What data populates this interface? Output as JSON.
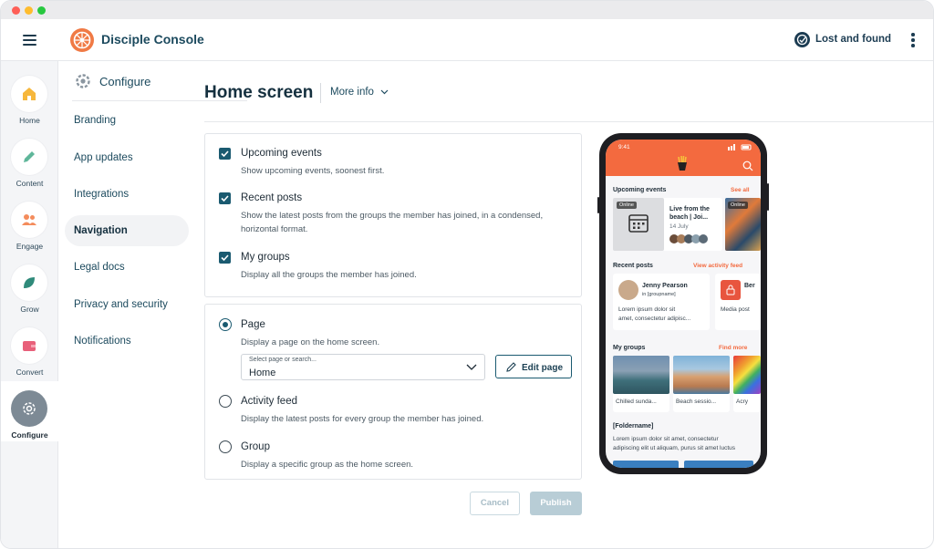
{
  "header": {
    "brand": "Disciple Console",
    "account": "Lost and found"
  },
  "rail": [
    {
      "label": "Home",
      "icon": "home-icon",
      "active": false
    },
    {
      "label": "Content",
      "icon": "pencil-icon",
      "active": false
    },
    {
      "label": "Engage",
      "icon": "people-icon",
      "active": false
    },
    {
      "label": "Grow",
      "icon": "leaf-icon",
      "active": false
    },
    {
      "label": "Convert",
      "icon": "wallet-icon",
      "active": false
    },
    {
      "label": "Configure",
      "icon": "gear-icon",
      "active": true
    }
  ],
  "subnav": {
    "title": "Configure",
    "items": [
      "Branding",
      "App updates",
      "Integrations",
      "Navigation",
      "Legal docs",
      "Privacy and security",
      "Notifications"
    ],
    "active": "Navigation"
  },
  "page": {
    "title": "Home screen",
    "more_info": "More info"
  },
  "sections": {
    "upcoming": {
      "title": "Upcoming events",
      "desc": "Show upcoming events, soonest first.",
      "checked": true
    },
    "recent": {
      "title": "Recent posts",
      "desc1": "Show the latest posts from the groups the member has joined, in a condensed,",
      "desc2": "horizontal format.",
      "checked": true
    },
    "groups": {
      "title": "My groups",
      "desc": "Display all the groups the member has joined.",
      "checked": true
    }
  },
  "home_type": {
    "page": {
      "title": "Page",
      "desc": "Display a page on the home screen.",
      "selected": true
    },
    "select_label": "Select page or search...",
    "select_value": "Home",
    "edit_button": "Edit page",
    "activity": {
      "title": "Activity feed",
      "desc": "Display the latest posts for every group the member has joined.",
      "selected": false
    },
    "group": {
      "title": "Group",
      "desc": "Display a specific group as the home screen.",
      "selected": false
    }
  },
  "actions": {
    "cancel": "Cancel",
    "publish": "Publish"
  },
  "phone": {
    "time": "9:41",
    "upcoming": "Upcoming events",
    "see_all": "See all",
    "online": "Online",
    "event_title1": "Live from the",
    "event_title2": "beach | Joi...",
    "event_date": "14 July",
    "recent": "Recent posts",
    "view_feed": "View activity feed",
    "post_author": "Jenny Pearson",
    "post_group": "in [groupname]",
    "post_text1": "Lorem ipsum dolor sit",
    "post_text2": "amet, consectetur adipisc...",
    "post2_author": "Ber",
    "post2_text": "Media post",
    "my_groups": "My groups",
    "find_more": "Find more",
    "group1": "Chilled sunda...",
    "group2": "Beach sessio...",
    "group3": "Acry",
    "folder": "[Foldername]",
    "folder_text1": "Lorem ipsum dolor sit amet, consectetur",
    "folder_text2": "adipiscing elit ut aliquam, purus sit amet luctus"
  },
  "colors": {
    "accent": "#f36a3f",
    "primary": "#1a5a70",
    "dark": "#15303f"
  }
}
